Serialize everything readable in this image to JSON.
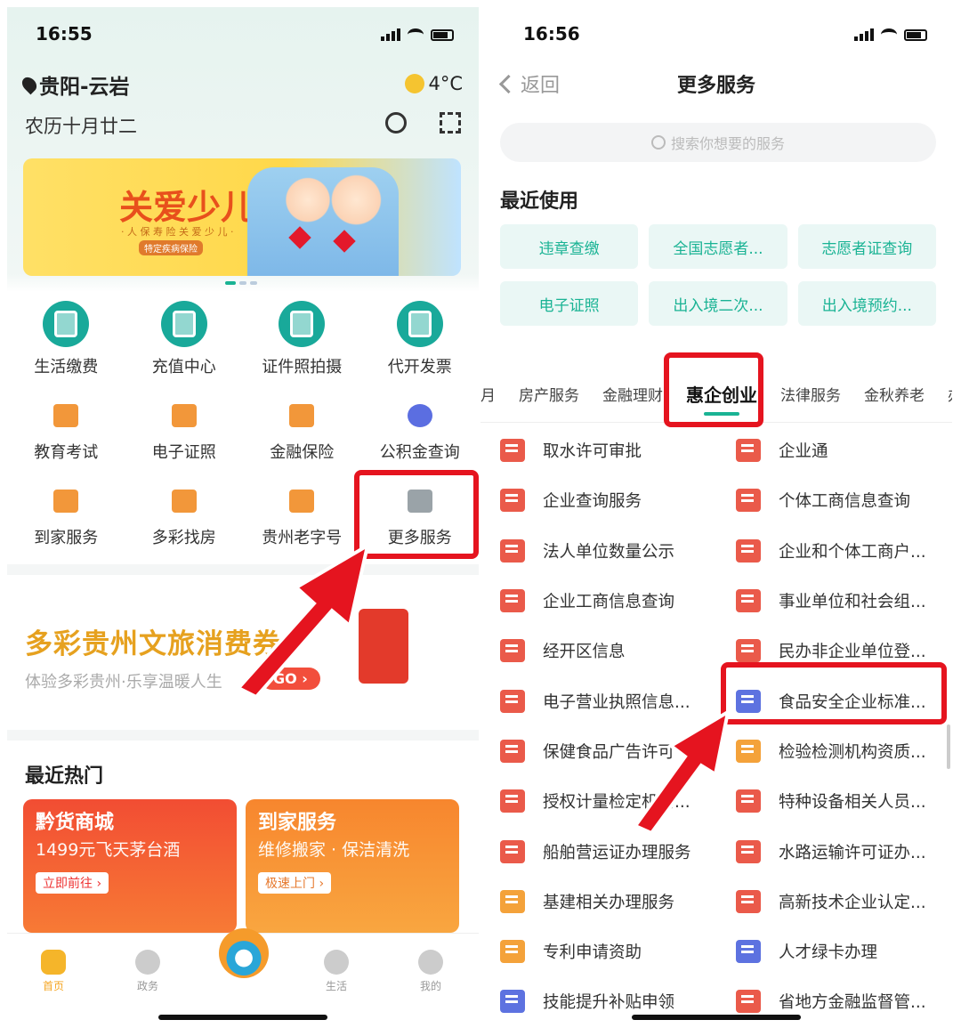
{
  "left": {
    "status": {
      "time": "16:55"
    },
    "header": {
      "location": "贵阳-云岩",
      "lunar_date": "农历十月廿二",
      "temperature": "4°C"
    },
    "banner": {
      "title": "关爱少儿",
      "subtitle": "· 人 保 寿 险 关 爱 少 儿 ·",
      "tag": "特定疾病保险"
    },
    "services": [
      {
        "label": "生活缴费",
        "icon": "water-drop-icon"
      },
      {
        "label": "充值中心",
        "icon": "phone-icon"
      },
      {
        "label": "证件照拍摄",
        "icon": "camera-icon"
      },
      {
        "label": "代开发票",
        "icon": "invoice-icon"
      },
      {
        "label": "教育考试",
        "icon": "graduation-cap-icon"
      },
      {
        "label": "电子证照",
        "icon": "id-card-icon"
      },
      {
        "label": "金融保险",
        "icon": "cart-icon"
      },
      {
        "label": "公积金查询",
        "icon": "fund-query-icon"
      },
      {
        "label": "到家服务",
        "icon": "broom-icon"
      },
      {
        "label": "多彩找房",
        "icon": "house-icon"
      },
      {
        "label": "贵州老字号",
        "icon": "shop-sign-icon"
      },
      {
        "label": "更多服务",
        "icon": "grid-icon"
      }
    ],
    "promo": {
      "title": "多彩贵州文旅消费券",
      "subtitle": "体验多彩贵州·乐享温暖人生",
      "button": "GO ›"
    },
    "hot": {
      "heading": "最近热门",
      "cards": [
        {
          "title": "黔货商城",
          "desc": "1499元飞天茅台酒",
          "button": "立即前往 ›"
        },
        {
          "title": "到家服务",
          "desc": "维修搬家 · 保洁清洗",
          "button": "极速上门 ›"
        }
      ]
    },
    "tabbar": [
      {
        "label": "首页",
        "icon": "home-icon"
      },
      {
        "label": "政务",
        "icon": "government-icon"
      },
      {
        "label": "",
        "icon": "mascot-icon"
      },
      {
        "label": "生活",
        "icon": "planet-icon"
      },
      {
        "label": "我的",
        "icon": "user-icon"
      }
    ]
  },
  "right": {
    "status": {
      "time": "16:56"
    },
    "nav": {
      "back": "返回",
      "title": "更多服务"
    },
    "search": {
      "placeholder": "搜索你想要的服务"
    },
    "recent": {
      "heading": "最近使用",
      "items": [
        "违章查缴",
        "全国志愿者...",
        "志愿者证查询",
        "电子证照",
        "出入境二次...",
        "出入境预约..."
      ]
    },
    "tabs": [
      "月",
      "房产服务",
      "金融理财",
      "惠企创业",
      "法律服务",
      "金秋养老",
      "办"
    ],
    "active_tab": "惠企创业",
    "services": [
      {
        "label": "取水许可审批",
        "color": "red"
      },
      {
        "label": "企业通",
        "color": "red"
      },
      {
        "label": "企业查询服务",
        "color": "red"
      },
      {
        "label": "个体工商信息查询",
        "color": "red"
      },
      {
        "label": "法人单位数量公示",
        "color": "red"
      },
      {
        "label": "企业和个体工商户...",
        "color": "red"
      },
      {
        "label": "企业工商信息查询",
        "color": "red"
      },
      {
        "label": "事业单位和社会组...",
        "color": "red"
      },
      {
        "label": "经开区信息",
        "color": "red"
      },
      {
        "label": "民办非企业单位登...",
        "color": "red"
      },
      {
        "label": "电子营业执照信息...",
        "color": "red"
      },
      {
        "label": "食品安全企业标准...",
        "color": "blue"
      },
      {
        "label": "保健食品广告许可",
        "color": "red"
      },
      {
        "label": "检验检测机构资质...",
        "color": "orange"
      },
      {
        "label": "授权计量检定机构...",
        "color": "red"
      },
      {
        "label": "特种设备相关人员...",
        "color": "red"
      },
      {
        "label": "船舶营运证办理服务",
        "color": "red"
      },
      {
        "label": "水路运输许可证办...",
        "color": "red"
      },
      {
        "label": "基建相关办理服务",
        "color": "orange"
      },
      {
        "label": "高新技术企业认定...",
        "color": "red"
      },
      {
        "label": "专利申请资助",
        "color": "orange"
      },
      {
        "label": "人才绿卡办理",
        "color": "blue"
      },
      {
        "label": "技能提升补贴申领",
        "color": "blue"
      },
      {
        "label": "省地方金融监督管...",
        "color": "red"
      }
    ]
  },
  "colors": {
    "accent": "#1ab394",
    "highlight": "#e5141f",
    "promo_title": "#e6a11f"
  }
}
